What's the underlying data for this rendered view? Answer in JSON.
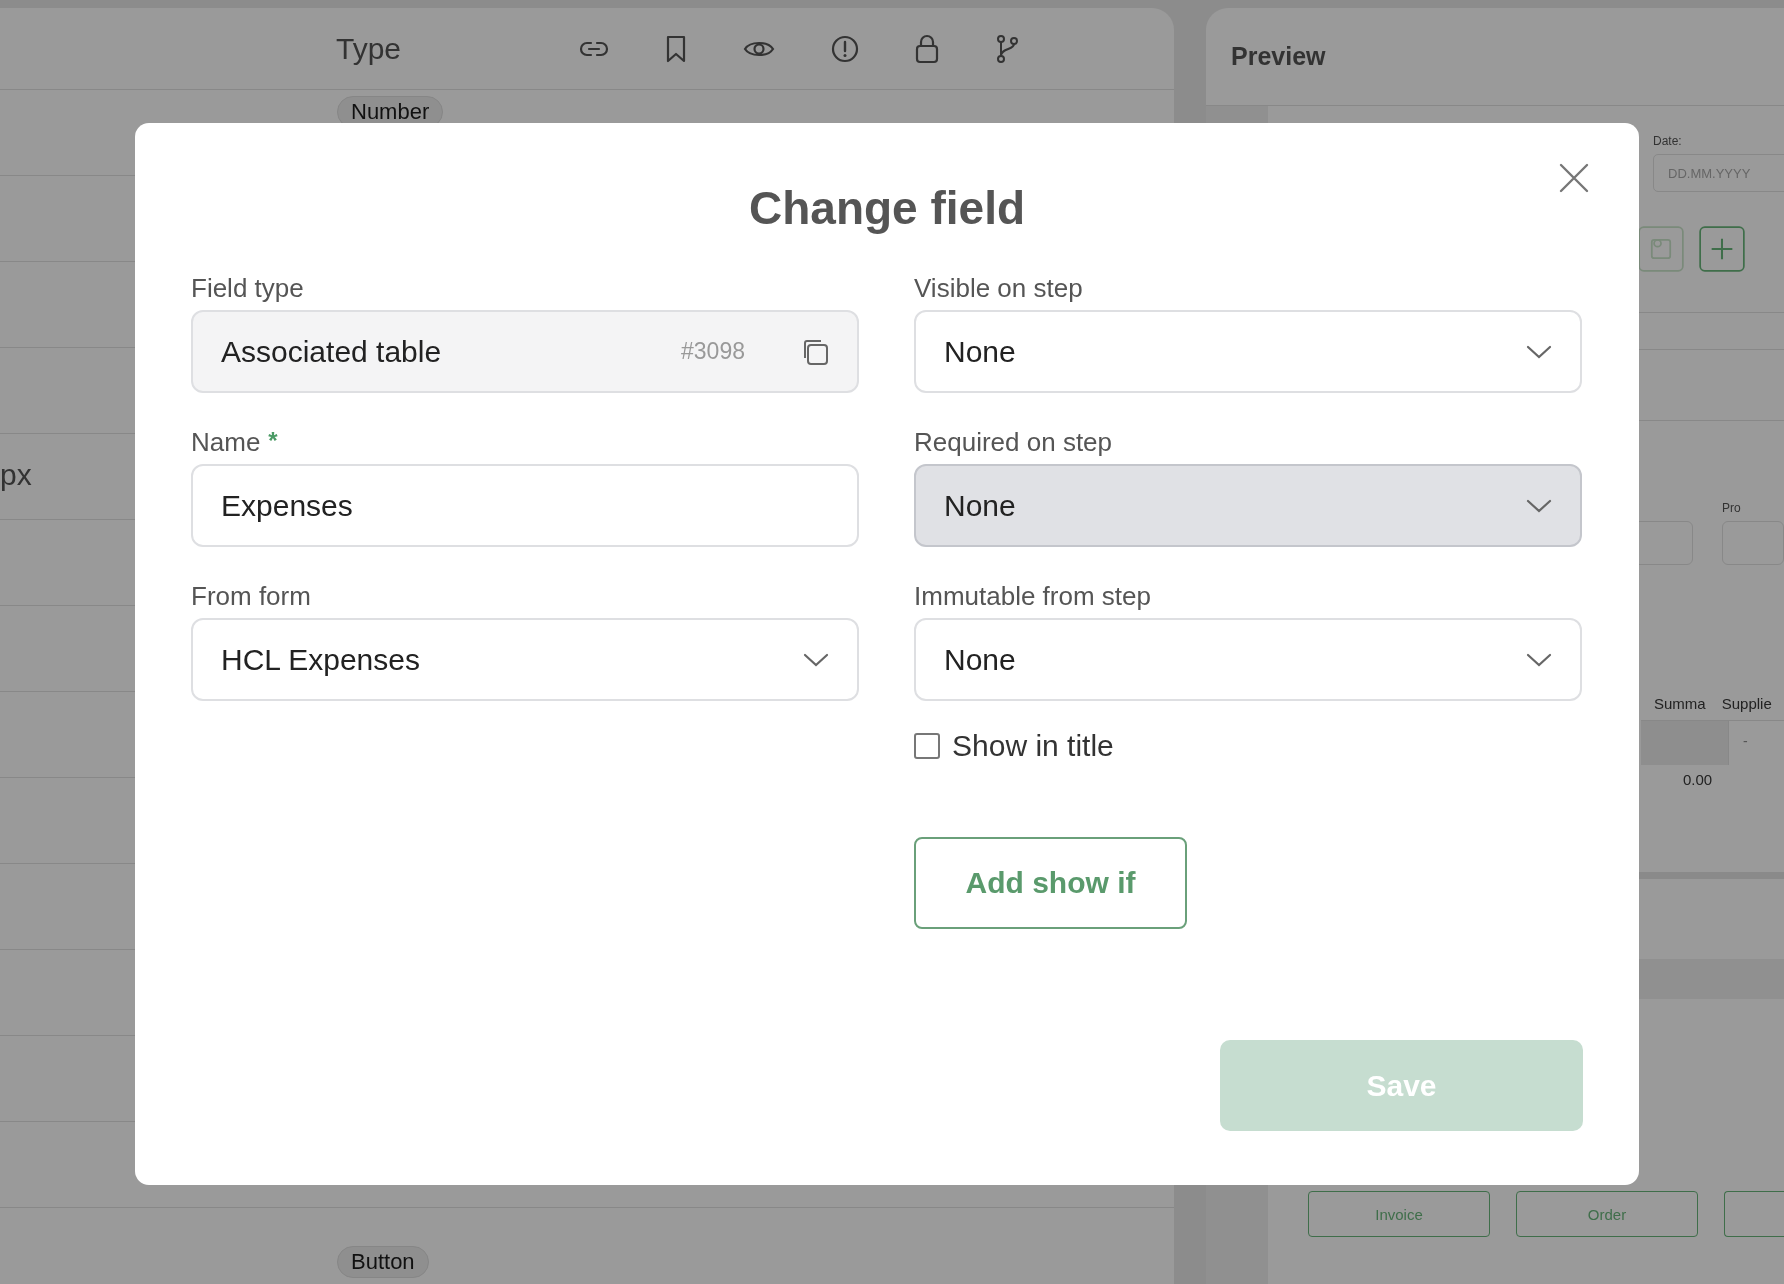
{
  "editor": {
    "column_header": "Type",
    "rows": [
      {
        "chip": "Number"
      },
      {},
      {},
      {},
      {
        "unit": "px"
      },
      {},
      {},
      {},
      {},
      {},
      {},
      {},
      {},
      {
        "chip": "Button"
      }
    ]
  },
  "preview": {
    "title": "Preview",
    "date_label": "Date:",
    "date_placeholder": "DD.MM.YYYY",
    "field_label": "Pro",
    "table_columns": [
      "Summa",
      "Supplie"
    ],
    "cell": "-",
    "total": "0.00",
    "buttons": [
      "Invoice",
      "Order"
    ]
  },
  "dialog": {
    "title": "Change field",
    "left_fields": [
      {
        "kind": "readonly",
        "label": "Field type",
        "value": "Associated table",
        "badge": "#3098"
      },
      {
        "kind": "text",
        "label": "Name",
        "required_mark": "*",
        "value": "Expenses"
      },
      {
        "kind": "select",
        "label": "From form",
        "value": "HCL Expenses"
      }
    ],
    "right_fields": [
      {
        "kind": "select",
        "label": "Visible on step",
        "value": "None",
        "highlighted": false
      },
      {
        "kind": "select",
        "label": "Required on step",
        "value": "None",
        "highlighted": true
      },
      {
        "kind": "select",
        "label": "Immutable from step",
        "value": "None",
        "highlighted": false
      }
    ],
    "checkbox": {
      "label": "Show in title",
      "checked": false
    },
    "add_button": "Add show if",
    "save_button": {
      "label": "Save",
      "disabled": true
    }
  }
}
